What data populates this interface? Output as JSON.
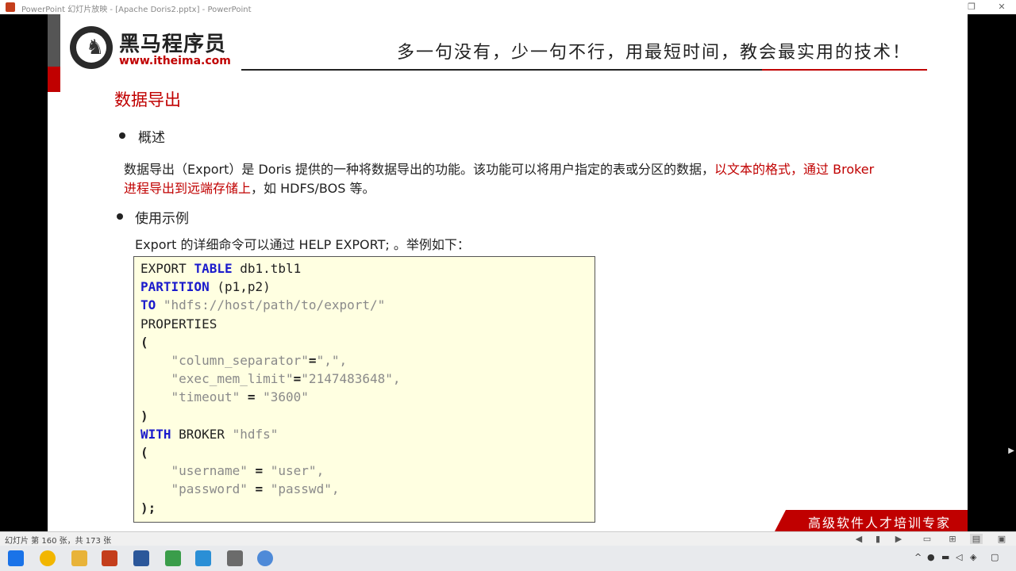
{
  "window": {
    "title": "PowerPoint 幻灯片放映 - [Apache Doris2.pptx] - PowerPoint",
    "restore_symbol": "❐",
    "close_symbol": "✕"
  },
  "slide": {
    "logo_cn": "黑马程序员",
    "logo_url": "www.itheima.com",
    "slogan": "多一句没有，少一句不行，用最短时间，教会最实用的技术！",
    "heading": "数据导出",
    "bullet1": "概述",
    "para_normal1": "数据导出（Export）是 Doris 提供的一种将数据导出的功能。该功能可以将用户指定的表或分区的数据，",
    "para_red": "以文本的格式，通过 Broker 进程导出到远端存储上",
    "para_normal2": "，如 HDFS/BOS 等。",
    "bullet2": "使用示例",
    "sub": "Export 的详细命令可以通过 HELP EXPORT; 。举例如下：",
    "code": {
      "export": "EXPORT ",
      "table_kw": "TABLE",
      "table_name": " db1.tbl1",
      "partition_kw": "PARTITION",
      "partition_val": " (p1,p2)",
      "to_kw": "TO",
      "to_path": " \"hdfs://host/path/to/export/\"",
      "properties": "PROPERTIES",
      "open_paren": "(",
      "col_sep_key": "    \"column_separator\"",
      "eq": "=",
      "col_sep_val": "\",\",",
      "exec_key": "    \"exec_mem_limit\"",
      "exec_val": "\"2147483648\",",
      "timeout_key": "    \"timeout\"",
      "eq_spaced": " = ",
      "timeout_val": "\"3600\"",
      "close_paren": ")",
      "with_kw": "WITH",
      "broker": " BROKER ",
      "broker_name": "\"hdfs\"",
      "user_key": "    \"username\"",
      "user_val": "\"user\",",
      "pass_key": "    \"password\"",
      "pass_val": "\"passwd\",",
      "end": ");"
    },
    "footer_banner": "高级软件人才培训专家"
  },
  "statusbar": {
    "slide_info": "幻灯片 第 160 张，共 173 张"
  },
  "colors": {
    "accent_red": "#c00000",
    "code_bg": "#ffffe1",
    "keyword_blue": "#1a1acc"
  }
}
